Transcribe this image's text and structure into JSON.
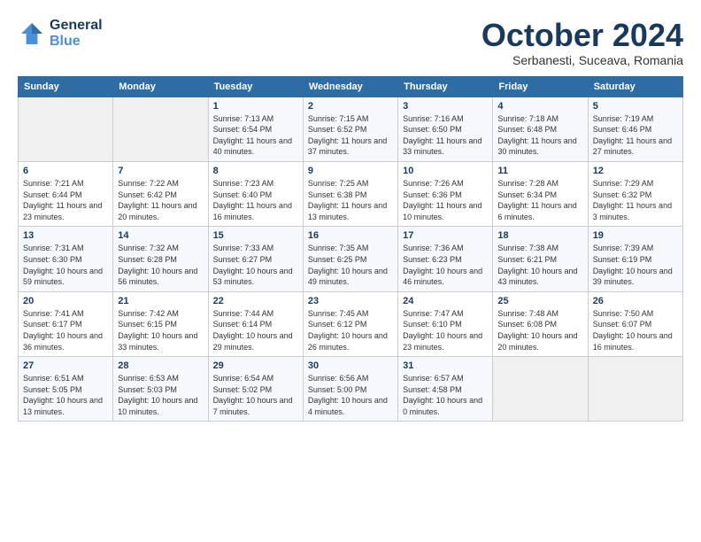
{
  "logo": {
    "line1": "General",
    "line2": "Blue"
  },
  "title": "October 2024",
  "subtitle": "Serbanesti, Suceava, Romania",
  "weekdays": [
    "Sunday",
    "Monday",
    "Tuesday",
    "Wednesday",
    "Thursday",
    "Friday",
    "Saturday"
  ],
  "weeks": [
    [
      {
        "day": "",
        "info": ""
      },
      {
        "day": "",
        "info": ""
      },
      {
        "day": "1",
        "info": "Sunrise: 7:13 AM\nSunset: 6:54 PM\nDaylight: 11 hours and 40 minutes."
      },
      {
        "day": "2",
        "info": "Sunrise: 7:15 AM\nSunset: 6:52 PM\nDaylight: 11 hours and 37 minutes."
      },
      {
        "day": "3",
        "info": "Sunrise: 7:16 AM\nSunset: 6:50 PM\nDaylight: 11 hours and 33 minutes."
      },
      {
        "day": "4",
        "info": "Sunrise: 7:18 AM\nSunset: 6:48 PM\nDaylight: 11 hours and 30 minutes."
      },
      {
        "day": "5",
        "info": "Sunrise: 7:19 AM\nSunset: 6:46 PM\nDaylight: 11 hours and 27 minutes."
      }
    ],
    [
      {
        "day": "6",
        "info": "Sunrise: 7:21 AM\nSunset: 6:44 PM\nDaylight: 11 hours and 23 minutes."
      },
      {
        "day": "7",
        "info": "Sunrise: 7:22 AM\nSunset: 6:42 PM\nDaylight: 11 hours and 20 minutes."
      },
      {
        "day": "8",
        "info": "Sunrise: 7:23 AM\nSunset: 6:40 PM\nDaylight: 11 hours and 16 minutes."
      },
      {
        "day": "9",
        "info": "Sunrise: 7:25 AM\nSunset: 6:38 PM\nDaylight: 11 hours and 13 minutes."
      },
      {
        "day": "10",
        "info": "Sunrise: 7:26 AM\nSunset: 6:36 PM\nDaylight: 11 hours and 10 minutes."
      },
      {
        "day": "11",
        "info": "Sunrise: 7:28 AM\nSunset: 6:34 PM\nDaylight: 11 hours and 6 minutes."
      },
      {
        "day": "12",
        "info": "Sunrise: 7:29 AM\nSunset: 6:32 PM\nDaylight: 11 hours and 3 minutes."
      }
    ],
    [
      {
        "day": "13",
        "info": "Sunrise: 7:31 AM\nSunset: 6:30 PM\nDaylight: 10 hours and 59 minutes."
      },
      {
        "day": "14",
        "info": "Sunrise: 7:32 AM\nSunset: 6:28 PM\nDaylight: 10 hours and 56 minutes."
      },
      {
        "day": "15",
        "info": "Sunrise: 7:33 AM\nSunset: 6:27 PM\nDaylight: 10 hours and 53 minutes."
      },
      {
        "day": "16",
        "info": "Sunrise: 7:35 AM\nSunset: 6:25 PM\nDaylight: 10 hours and 49 minutes."
      },
      {
        "day": "17",
        "info": "Sunrise: 7:36 AM\nSunset: 6:23 PM\nDaylight: 10 hours and 46 minutes."
      },
      {
        "day": "18",
        "info": "Sunrise: 7:38 AM\nSunset: 6:21 PM\nDaylight: 10 hours and 43 minutes."
      },
      {
        "day": "19",
        "info": "Sunrise: 7:39 AM\nSunset: 6:19 PM\nDaylight: 10 hours and 39 minutes."
      }
    ],
    [
      {
        "day": "20",
        "info": "Sunrise: 7:41 AM\nSunset: 6:17 PM\nDaylight: 10 hours and 36 minutes."
      },
      {
        "day": "21",
        "info": "Sunrise: 7:42 AM\nSunset: 6:15 PM\nDaylight: 10 hours and 33 minutes."
      },
      {
        "day": "22",
        "info": "Sunrise: 7:44 AM\nSunset: 6:14 PM\nDaylight: 10 hours and 29 minutes."
      },
      {
        "day": "23",
        "info": "Sunrise: 7:45 AM\nSunset: 6:12 PM\nDaylight: 10 hours and 26 minutes."
      },
      {
        "day": "24",
        "info": "Sunrise: 7:47 AM\nSunset: 6:10 PM\nDaylight: 10 hours and 23 minutes."
      },
      {
        "day": "25",
        "info": "Sunrise: 7:48 AM\nSunset: 6:08 PM\nDaylight: 10 hours and 20 minutes."
      },
      {
        "day": "26",
        "info": "Sunrise: 7:50 AM\nSunset: 6:07 PM\nDaylight: 10 hours and 16 minutes."
      }
    ],
    [
      {
        "day": "27",
        "info": "Sunrise: 6:51 AM\nSunset: 5:05 PM\nDaylight: 10 hours and 13 minutes."
      },
      {
        "day": "28",
        "info": "Sunrise: 6:53 AM\nSunset: 5:03 PM\nDaylight: 10 hours and 10 minutes."
      },
      {
        "day": "29",
        "info": "Sunrise: 6:54 AM\nSunset: 5:02 PM\nDaylight: 10 hours and 7 minutes."
      },
      {
        "day": "30",
        "info": "Sunrise: 6:56 AM\nSunset: 5:00 PM\nDaylight: 10 hours and 4 minutes."
      },
      {
        "day": "31",
        "info": "Sunrise: 6:57 AM\nSunset: 4:58 PM\nDaylight: 10 hours and 0 minutes."
      },
      {
        "day": "",
        "info": ""
      },
      {
        "day": "",
        "info": ""
      }
    ]
  ]
}
